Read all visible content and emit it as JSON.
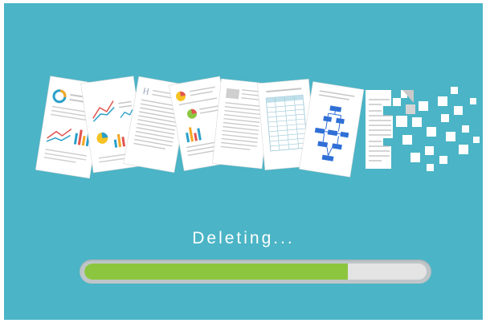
{
  "status": {
    "label": "Deleting..."
  },
  "progress": {
    "fraction": 0.77,
    "fill_color": "#8cc63f",
    "track_color": "#e4e4e4"
  },
  "background_color": "#4bb4c6",
  "illustration": {
    "icons": [
      "document-pie-chart-icon",
      "document-line-chart-icon",
      "document-text-icon",
      "document-pie-bars-icon",
      "document-text-icon",
      "document-table-icon",
      "document-flowchart-icon",
      "dissolving-document-icon"
    ]
  }
}
